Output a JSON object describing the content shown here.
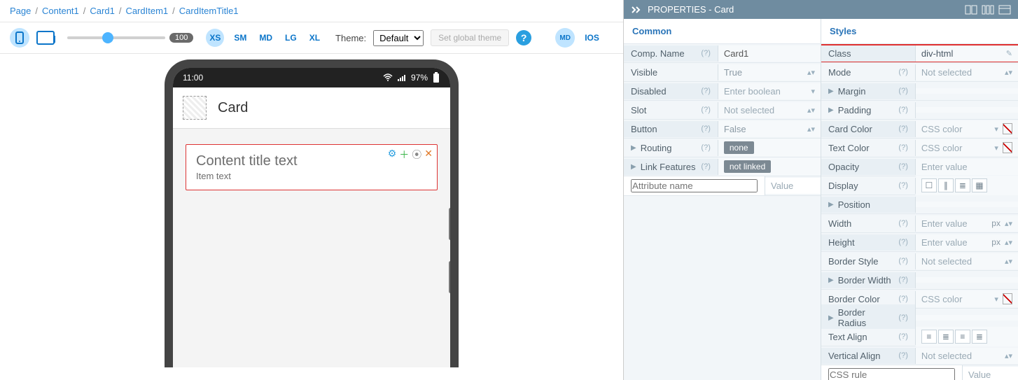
{
  "breadcrumb": [
    "Page",
    "Content1",
    "Card1",
    "CardItem1",
    "CardItemTitle1"
  ],
  "toolbar": {
    "zoom": "100",
    "breakpoints": {
      "xs": "XS",
      "sm": "SM",
      "md": "MD",
      "lg": "LG",
      "xl": "XL"
    },
    "theme_label": "Theme:",
    "theme_value": "Default",
    "global_theme_btn": "Set global theme",
    "md_badge": "MD",
    "ios": "IOS"
  },
  "device": {
    "time": "11:00",
    "battery": "97%",
    "header_title": "Card",
    "card_title": "Content title text",
    "card_item": "Item text"
  },
  "panel": {
    "title": "PROPERTIES - Card",
    "common_label": "Common",
    "styles_label": "Styles",
    "common": {
      "comp_name": {
        "label": "Comp. Name",
        "value": "Card1"
      },
      "visible": {
        "label": "Visible",
        "value": "True"
      },
      "disabled": {
        "label": "Disabled",
        "placeholder": "Enter boolean"
      },
      "slot": {
        "label": "Slot",
        "placeholder": "Not selected"
      },
      "button": {
        "label": "Button",
        "value": "False"
      },
      "routing": {
        "label": "Routing",
        "value": "none"
      },
      "link": {
        "label": "Link Features",
        "value": "not linked"
      },
      "attr": {
        "label": "Attribute name",
        "placeholder": "Value"
      }
    },
    "styles": {
      "class": {
        "label": "Class",
        "value": "div-html"
      },
      "mode": {
        "label": "Mode",
        "placeholder": "Not selected"
      },
      "margin": {
        "label": "Margin"
      },
      "padding": {
        "label": "Padding"
      },
      "card_color": {
        "label": "Card Color",
        "placeholder": "CSS color"
      },
      "text_color": {
        "label": "Text Color",
        "placeholder": "CSS color"
      },
      "opacity": {
        "label": "Opacity",
        "placeholder": "Enter value"
      },
      "display": {
        "label": "Display"
      },
      "position": {
        "label": "Position"
      },
      "width": {
        "label": "Width",
        "placeholder": "Enter value",
        "unit": "px"
      },
      "height": {
        "label": "Height",
        "placeholder": "Enter value",
        "unit": "px"
      },
      "border_style": {
        "label": "Border Style",
        "placeholder": "Not selected"
      },
      "border_width": {
        "label": "Border Width"
      },
      "border_color": {
        "label": "Border Color",
        "placeholder": "CSS color"
      },
      "border_radius": {
        "label": "Border Radius"
      },
      "text_align": {
        "label": "Text Align"
      },
      "vertical_align": {
        "label": "Vertical Align",
        "placeholder": "Not selected"
      },
      "css_rule": {
        "label": "CSS rule",
        "placeholder": "Value"
      }
    }
  }
}
